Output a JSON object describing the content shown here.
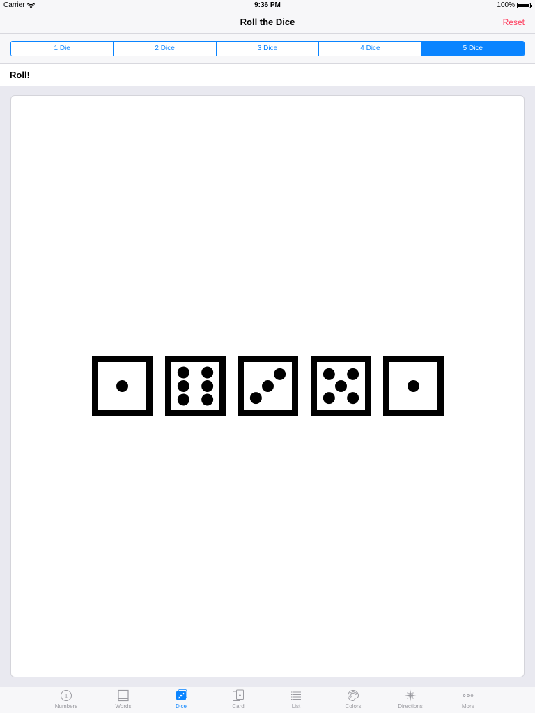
{
  "status_bar": {
    "carrier": "Carrier",
    "time": "9:36 PM",
    "battery": "100%"
  },
  "nav": {
    "title": "Roll the Dice",
    "reset_label": "Reset"
  },
  "segments": {
    "items": [
      "1 Die",
      "2 Dice",
      "3 Dice",
      "4 Dice",
      "5 Dice"
    ],
    "selected": "5 Dice"
  },
  "roll_label": "Roll!",
  "dice": [
    1,
    6,
    3,
    5,
    1
  ],
  "tab_bar": {
    "items": [
      {
        "label": "Numbers",
        "icon": "number-circle-icon"
      },
      {
        "label": "Words",
        "icon": "book-icon"
      },
      {
        "label": "Dice",
        "icon": "dice-icon"
      },
      {
        "label": "Card",
        "icon": "cards-icon"
      },
      {
        "label": "List",
        "icon": "list-icon"
      },
      {
        "label": "Colors",
        "icon": "palette-icon"
      },
      {
        "label": "Directions",
        "icon": "compass-icon"
      },
      {
        "label": "More",
        "icon": "more-icon"
      }
    ],
    "selected": "Dice"
  },
  "colors": {
    "accent": "#0a84ff",
    "reset": "#ff3b5c",
    "inactive_tab": "#9a9aa0"
  }
}
